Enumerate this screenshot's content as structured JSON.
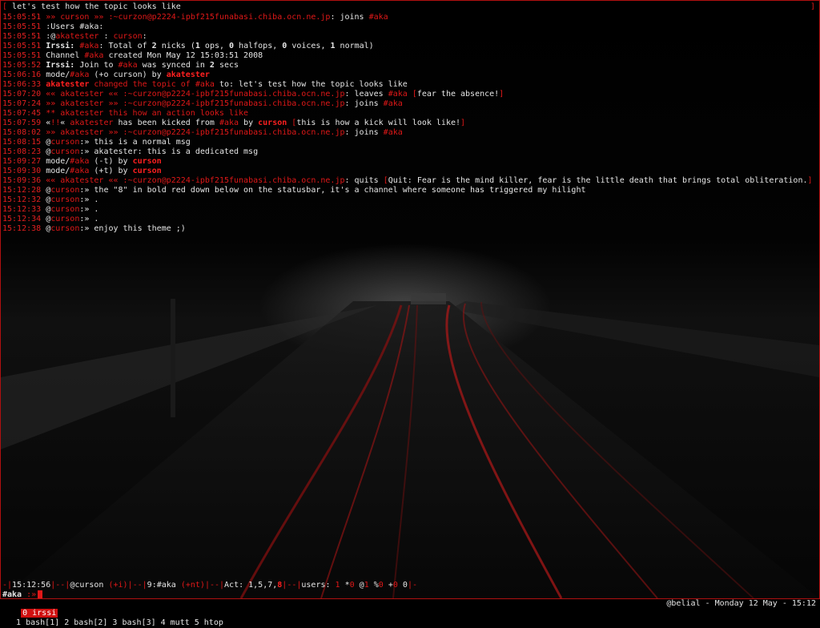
{
  "topic": {
    "left_bracket": "[",
    "text": " let's test how the topic looks like",
    "right_bracket": "]"
  },
  "log": [
    {
      "ts": "15:05:51",
      "parts": [
        {
          "c": "r",
          "t": " »» "
        },
        {
          "c": "r",
          "t": "curson"
        },
        {
          "c": "r",
          "t": " »» "
        },
        {
          "c": "r",
          "t": ":~curzon@p2224-ipbf215funabasi.chiba.ocn.ne.jp"
        },
        {
          "c": "w",
          "t": ": joins "
        },
        {
          "c": "r",
          "t": "#aka"
        }
      ]
    },
    {
      "ts": "15:05:51",
      "parts": [
        {
          "c": "w",
          "t": " :Users #aka:"
        }
      ]
    },
    {
      "ts": "15:05:51",
      "parts": [
        {
          "c": "w",
          "t": " :@"
        },
        {
          "c": "r",
          "t": "akatester"
        },
        {
          "c": "w",
          "t": " : "
        },
        {
          "c": "r",
          "t": "curson"
        },
        {
          "c": "w",
          "t": ":"
        }
      ]
    },
    {
      "ts": "15:05:51",
      "parts": [
        {
          "c": "b",
          "t": " Irssi: "
        },
        {
          "c": "r",
          "t": "#aka"
        },
        {
          "c": "w",
          "t": ": Total of "
        },
        {
          "c": "b",
          "t": "2"
        },
        {
          "c": "w",
          "t": " nicks ("
        },
        {
          "c": "b",
          "t": "1"
        },
        {
          "c": "w",
          "t": " ops, "
        },
        {
          "c": "b",
          "t": "0"
        },
        {
          "c": "w",
          "t": " halfops, "
        },
        {
          "c": "b",
          "t": "0"
        },
        {
          "c": "w",
          "t": " voices, "
        },
        {
          "c": "b",
          "t": "1"
        },
        {
          "c": "w",
          "t": " normal)"
        }
      ]
    },
    {
      "ts": "15:05:51",
      "parts": [
        {
          "c": "w",
          "t": " Channel "
        },
        {
          "c": "r",
          "t": "#aka"
        },
        {
          "c": "w",
          "t": " created Mon May 12 15:03:51 2008"
        }
      ]
    },
    {
      "ts": "15:05:52",
      "parts": [
        {
          "c": "b",
          "t": " Irssi: "
        },
        {
          "c": "w",
          "t": "Join to "
        },
        {
          "c": "r",
          "t": "#aka"
        },
        {
          "c": "w",
          "t": " was synced in "
        },
        {
          "c": "b",
          "t": "2"
        },
        {
          "c": "w",
          "t": " secs"
        }
      ]
    },
    {
      "ts": "15:06:16",
      "parts": [
        {
          "c": "w",
          "t": " mode/"
        },
        {
          "c": "r",
          "t": "#aka"
        },
        {
          "c": "w",
          "t": " (+o curson) by "
        },
        {
          "c": "n",
          "t": "akatester"
        }
      ]
    },
    {
      "ts": "15:06:33",
      "parts": [
        {
          "c": "n",
          "t": " akatester"
        },
        {
          "c": "r",
          "t": " changed the topic of "
        },
        {
          "c": "r",
          "t": "#aka"
        },
        {
          "c": "w",
          "t": " to: let's test how the topic looks like"
        }
      ]
    },
    {
      "ts": "15:07:20",
      "parts": [
        {
          "c": "r",
          "t": " «« "
        },
        {
          "c": "r",
          "t": "akatester"
        },
        {
          "c": "r",
          "t": " «« "
        },
        {
          "c": "r",
          "t": ":~curzon@p2224-ipbf215funabasi.chiba.ocn.ne.jp"
        },
        {
          "c": "w",
          "t": ": leaves "
        },
        {
          "c": "r",
          "t": "#aka"
        },
        {
          "c": "r",
          "t": " ["
        },
        {
          "c": "w",
          "t": "fear the absence!"
        },
        {
          "c": "r",
          "t": "]"
        }
      ]
    },
    {
      "ts": "15:07:24",
      "parts": [
        {
          "c": "r",
          "t": " »» "
        },
        {
          "c": "r",
          "t": "akatester"
        },
        {
          "c": "r",
          "t": " »» "
        },
        {
          "c": "r",
          "t": ":~curzon@p2224-ipbf215funabasi.chiba.ocn.ne.jp"
        },
        {
          "c": "w",
          "t": ": joins "
        },
        {
          "c": "r",
          "t": "#aka"
        }
      ]
    },
    {
      "ts": "15:07:45",
      "parts": [
        {
          "c": "r",
          "t": " ** akatester this how an action looks like"
        }
      ]
    },
    {
      "ts": "15:07:59",
      "parts": [
        {
          "c": "w",
          "t": " «"
        },
        {
          "c": "r",
          "t": "!!"
        },
        {
          "c": "w",
          "t": "« "
        },
        {
          "c": "r",
          "t": "akatester"
        },
        {
          "c": "w",
          "t": " has been kicked from "
        },
        {
          "c": "r",
          "t": "#aka"
        },
        {
          "c": "w",
          "t": " by "
        },
        {
          "c": "n",
          "t": "curson"
        },
        {
          "c": "r",
          "t": " ["
        },
        {
          "c": "w",
          "t": "this is how a kick will look like!"
        },
        {
          "c": "r",
          "t": "]"
        }
      ]
    },
    {
      "ts": "15:08:02",
      "parts": [
        {
          "c": "r",
          "t": " »» "
        },
        {
          "c": "r",
          "t": "akatester"
        },
        {
          "c": "r",
          "t": " »» "
        },
        {
          "c": "r",
          "t": ":~curzon@p2224-ipbf215funabasi.chiba.ocn.ne.jp"
        },
        {
          "c": "w",
          "t": ": joins "
        },
        {
          "c": "r",
          "t": "#aka"
        }
      ]
    },
    {
      "ts": "15:08:15",
      "parts": [
        {
          "c": "w",
          "t": " @"
        },
        {
          "c": "r",
          "t": "curson"
        },
        {
          "c": "w",
          "t": ":» this is a normal msg"
        }
      ]
    },
    {
      "ts": "15:08:23",
      "parts": [
        {
          "c": "w",
          "t": " @"
        },
        {
          "c": "r",
          "t": "curson"
        },
        {
          "c": "w",
          "t": ":» akatester: this is a dedicated msg"
        }
      ]
    },
    {
      "ts": "15:09:27",
      "parts": [
        {
          "c": "w",
          "t": " mode/"
        },
        {
          "c": "r",
          "t": "#aka"
        },
        {
          "c": "w",
          "t": " (-t) by "
        },
        {
          "c": "n",
          "t": "curson"
        }
      ]
    },
    {
      "ts": "15:09:30",
      "parts": [
        {
          "c": "w",
          "t": " mode/"
        },
        {
          "c": "r",
          "t": "#aka"
        },
        {
          "c": "w",
          "t": " (+t) by "
        },
        {
          "c": "n",
          "t": "curson"
        }
      ]
    },
    {
      "ts": "15:09:36",
      "parts": [
        {
          "c": "r",
          "t": " «« "
        },
        {
          "c": "r",
          "t": "akatester"
        },
        {
          "c": "r",
          "t": " «« "
        },
        {
          "c": "r",
          "t": ":~curzon@p2224-ipbf215funabasi.chiba.ocn.ne.jp"
        },
        {
          "c": "w",
          "t": ": quits "
        },
        {
          "c": "r",
          "t": "["
        },
        {
          "c": "w",
          "t": "Quit: Fear is the mind killer, fear is the little death that brings total obliteration."
        },
        {
          "c": "r",
          "t": "]"
        }
      ]
    },
    {
      "ts": "15:12:28",
      "parts": [
        {
          "c": "w",
          "t": " @"
        },
        {
          "c": "r",
          "t": "curson"
        },
        {
          "c": "w",
          "t": ":» the \"8\" in bold red down below on the statusbar, it's a channel where someone has triggered my hilight"
        }
      ]
    },
    {
      "ts": "15:12:32",
      "parts": [
        {
          "c": "w",
          "t": " @"
        },
        {
          "c": "r",
          "t": "curson"
        },
        {
          "c": "w",
          "t": ":» ."
        }
      ]
    },
    {
      "ts": "15:12:33",
      "parts": [
        {
          "c": "w",
          "t": " @"
        },
        {
          "c": "r",
          "t": "curson"
        },
        {
          "c": "w",
          "t": ":» ."
        }
      ]
    },
    {
      "ts": "15:12:34",
      "parts": [
        {
          "c": "w",
          "t": " @"
        },
        {
          "c": "r",
          "t": "curson"
        },
        {
          "c": "w",
          "t": ":» ."
        }
      ]
    },
    {
      "ts": "15:12:38",
      "parts": [
        {
          "c": "w",
          "t": " @"
        },
        {
          "c": "r",
          "t": "curson"
        },
        {
          "c": "w",
          "t": ":» enjoy this theme ;)"
        }
      ]
    }
  ],
  "statusbar": [
    {
      "c": "r",
      "t": "-|"
    },
    {
      "c": "w",
      "t": "15:12:56"
    },
    {
      "c": "r",
      "t": "|--|"
    },
    {
      "c": "w",
      "t": "@curson "
    },
    {
      "c": "r",
      "t": "(+i)"
    },
    {
      "c": "r",
      "t": "|--|"
    },
    {
      "c": "w",
      "t": "9:#aka "
    },
    {
      "c": "r",
      "t": "(+nt)"
    },
    {
      "c": "r",
      "t": "|--|"
    },
    {
      "c": "w",
      "t": "Act: 1,5,7,"
    },
    {
      "c": "n",
      "t": "8"
    },
    {
      "c": "r",
      "t": "|--|"
    },
    {
      "c": "w",
      "t": "users: "
    },
    {
      "c": "r",
      "t": "1 "
    },
    {
      "c": "w",
      "t": "*"
    },
    {
      "c": "r",
      "t": "0 "
    },
    {
      "c": "w",
      "t": "@"
    },
    {
      "c": "r",
      "t": "1 "
    },
    {
      "c": "w",
      "t": "%"
    },
    {
      "c": "r",
      "t": "0 "
    },
    {
      "c": "w",
      "t": "+"
    },
    {
      "c": "r",
      "t": "0 "
    },
    {
      "c": "w",
      "t": "0"
    },
    {
      "c": "r",
      "t": "|-"
    }
  ],
  "prompt": {
    "channel": "#aka",
    "arrow": " :»"
  },
  "screen_tabs": {
    "active": "0 irssi",
    "others": [
      "1 bash[1]",
      "2 bash[2]",
      "3 bash[3]",
      "4 mutt",
      "5 htop"
    ]
  },
  "screen_status": "@belial - Monday 12 May - 15:12",
  "colors": {
    "accent": "#e01818",
    "text": "#e6e6e6",
    "background": "#000000"
  }
}
